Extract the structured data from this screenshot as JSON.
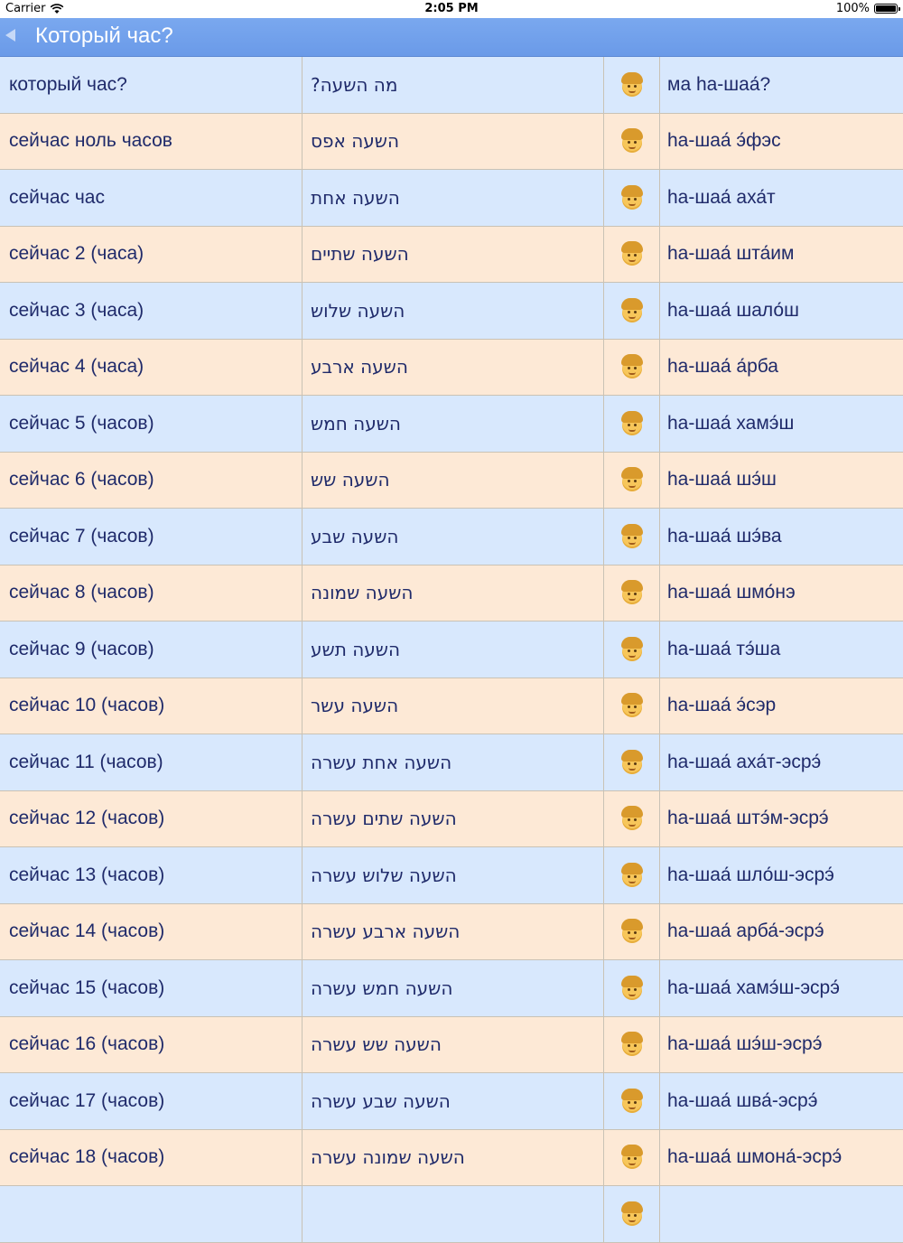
{
  "status": {
    "carrier": "Carrier",
    "time": "2:05 PM",
    "battery": "100%",
    "battery_level": 1.0
  },
  "nav": {
    "title": "Который час?",
    "back_icon": "back-triangle-icon",
    "color": "#6a9ae8"
  },
  "rows": [
    {
      "ru": "который час?",
      "he": "מה השעה?",
      "tr": "ма hа-шаа́?"
    },
    {
      "ru": "сейчас ноль часов",
      "he": "השעה אפס",
      "tr": "hа-шаа́ э́фэс"
    },
    {
      "ru": "сейчас час",
      "he": "השעה אחת",
      "tr": "hа-шаа́ аха́т"
    },
    {
      "ru": "сейчас 2 (часа)",
      "he": "השעה שתיים",
      "tr": "hа-шаа́ шта́им"
    },
    {
      "ru": "сейчас 3 (часа)",
      "he": "השעה שלוש",
      "tr": "hа-шаа́ шало́ш"
    },
    {
      "ru": "сейчас 4 (часа)",
      "he": "השעה ארבע",
      "tr": "hа-шаа́ а́рба"
    },
    {
      "ru": "сейчас 5 (часов)",
      "he": "השעה חמש",
      "tr": "hа-шаа́ хамэ́ш"
    },
    {
      "ru": "сейчас 6 (часов)",
      "he": "השעה שש",
      "tr": "hа-шаа́ шэ́ш"
    },
    {
      "ru": "сейчас 7 (часов)",
      "he": "השעה שבע",
      "tr": "hа-шаа́ шэ́ва"
    },
    {
      "ru": "сейчас 8 (часов)",
      "he": "השעה שמונה",
      "tr": "hа-шаа́ шмо́нэ"
    },
    {
      "ru": "сейчас 9 (часов)",
      "he": "השעה תשע",
      "tr": "hа-шаа́ тэ́ша"
    },
    {
      "ru": "сейчас 10 (часов)",
      "he": "השעה עשר",
      "tr": "hа-шаа́ э́сэр"
    },
    {
      "ru": "сейчас 11 (часов)",
      "he": "השעה אחת עשרה",
      "tr": "hа-шаа́ аха́т-эсрэ́"
    },
    {
      "ru": "сейчас 12 (часов)",
      "he": "השעה שתים עשרה",
      "tr": "hа-шаа́ штэ́м-эсрэ́"
    },
    {
      "ru": "сейчас 13 (часов)",
      "he": "השעה שלוש עשרה",
      "tr": "hа-шаа́ шло́ш-эсрэ́"
    },
    {
      "ru": "сейчас 14 (часов)",
      "he": "השעה ארבע עשרה",
      "tr": "hа-шаа́ арба́-эсрэ́"
    },
    {
      "ru": "сейчас 15 (часов)",
      "he": "השעה חמש עשרה",
      "tr": "hа-шаа́ хамэ́ш-эсрэ́"
    },
    {
      "ru": "сейчас 16 (часов)",
      "he": "השעה שש עשרה",
      "tr": "hа-шаа́ шэ́ш-эсрэ́"
    },
    {
      "ru": "сейчас 17 (часов)",
      "he": "השעה שבע עשרה",
      "tr": "hа-шаа́ шва́-эсрэ́"
    },
    {
      "ru": "сейчас 18 (часов)",
      "he": "השעה שמונה עשרה",
      "tr": "hа-шаа́ шмона́-эсрэ́"
    },
    {
      "ru": "",
      "he": "",
      "tr": ""
    }
  ],
  "audio_icon": "male-face-icon",
  "colors": {
    "row_blue": "#d8e8fd",
    "row_peach": "#fde9d6",
    "text": "#1f2a6a"
  }
}
